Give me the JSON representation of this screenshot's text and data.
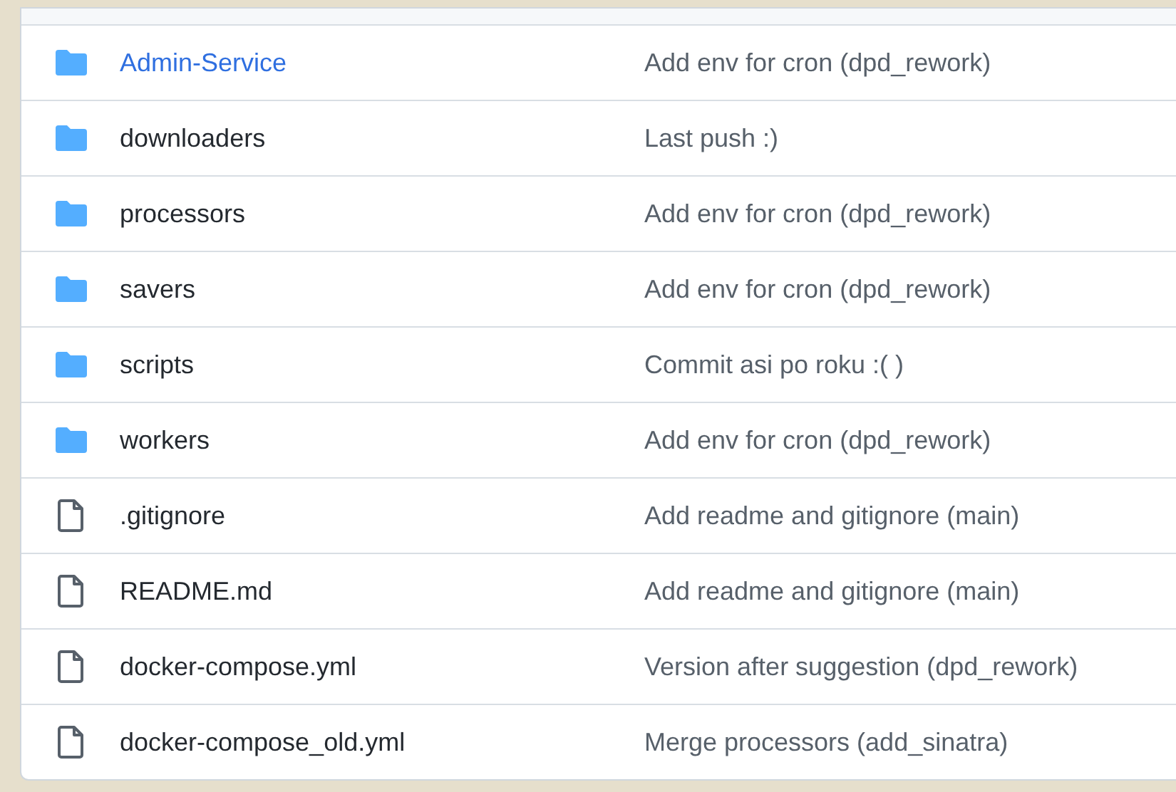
{
  "files": [
    {
      "kind": "folder",
      "name": "Admin-Service",
      "highlighted": true,
      "message": "Add env for cron (dpd_rework)"
    },
    {
      "kind": "folder",
      "name": "downloaders",
      "highlighted": false,
      "message": "Last push :)"
    },
    {
      "kind": "folder",
      "name": "processors",
      "highlighted": false,
      "message": "Add env for cron (dpd_rework)"
    },
    {
      "kind": "folder",
      "name": "savers",
      "highlighted": false,
      "message": "Add env for cron (dpd_rework)"
    },
    {
      "kind": "folder",
      "name": "scripts",
      "highlighted": false,
      "message": "Commit asi po roku :( )"
    },
    {
      "kind": "folder",
      "name": "workers",
      "highlighted": false,
      "message": "Add env for cron (dpd_rework)"
    },
    {
      "kind": "file",
      "name": ".gitignore",
      "highlighted": false,
      "message": "Add readme and gitignore (main)"
    },
    {
      "kind": "file",
      "name": "README.md",
      "highlighted": false,
      "message": "Add readme and gitignore (main)"
    },
    {
      "kind": "file",
      "name": "docker-compose.yml",
      "highlighted": false,
      "message": "Version after suggestion (dpd_rework)"
    },
    {
      "kind": "file",
      "name": "docker-compose_old.yml",
      "highlighted": false,
      "message": "Merge processors (add_sinatra)"
    }
  ]
}
